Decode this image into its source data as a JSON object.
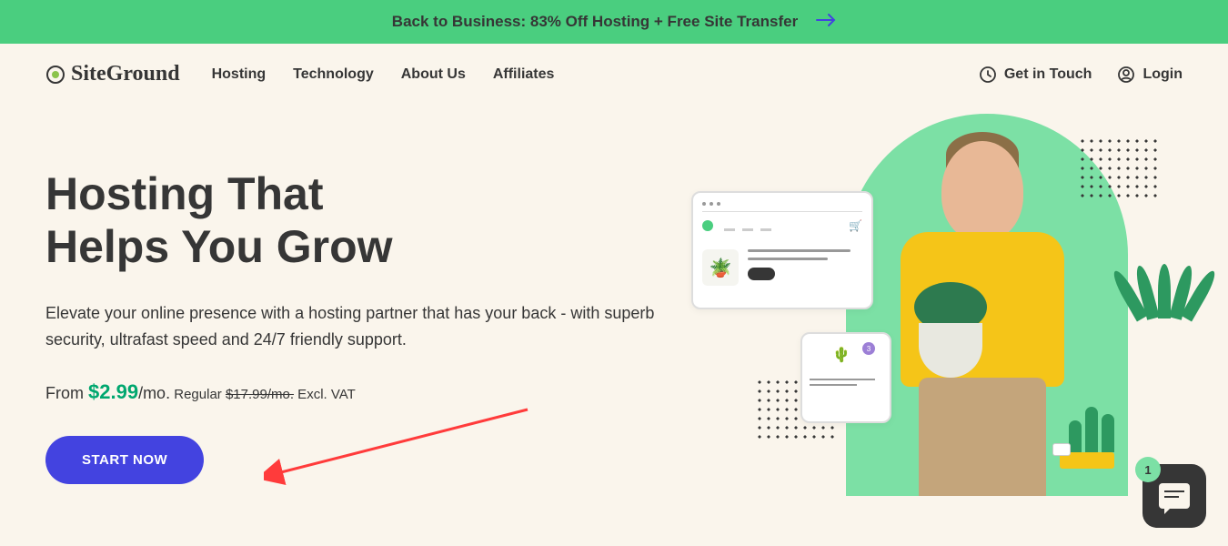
{
  "promo": {
    "text": "Back to Business: 83% Off Hosting + Free Site Transfer"
  },
  "logo": {
    "text": "SiteGround"
  },
  "nav": {
    "items": [
      "Hosting",
      "Technology",
      "About Us",
      "Affiliates"
    ]
  },
  "header_links": {
    "contact": "Get in Touch",
    "login": "Login"
  },
  "hero": {
    "title_line1": "Hosting That",
    "title_line2": "Helps You Grow",
    "description": "Elevate your online presence with a hosting partner that has your back - with superb security, ultrafast speed and 24/7 friendly support.",
    "price_from": "From ",
    "price_value": "$2.99",
    "price_period": "/mo.",
    "price_regular_label": " Regular ",
    "price_strike": "$17.99/mo.",
    "price_vat": " Excl. VAT",
    "cta": "START NOW"
  },
  "product_card": {
    "badge_count": "3"
  },
  "chat": {
    "badge": "1"
  }
}
